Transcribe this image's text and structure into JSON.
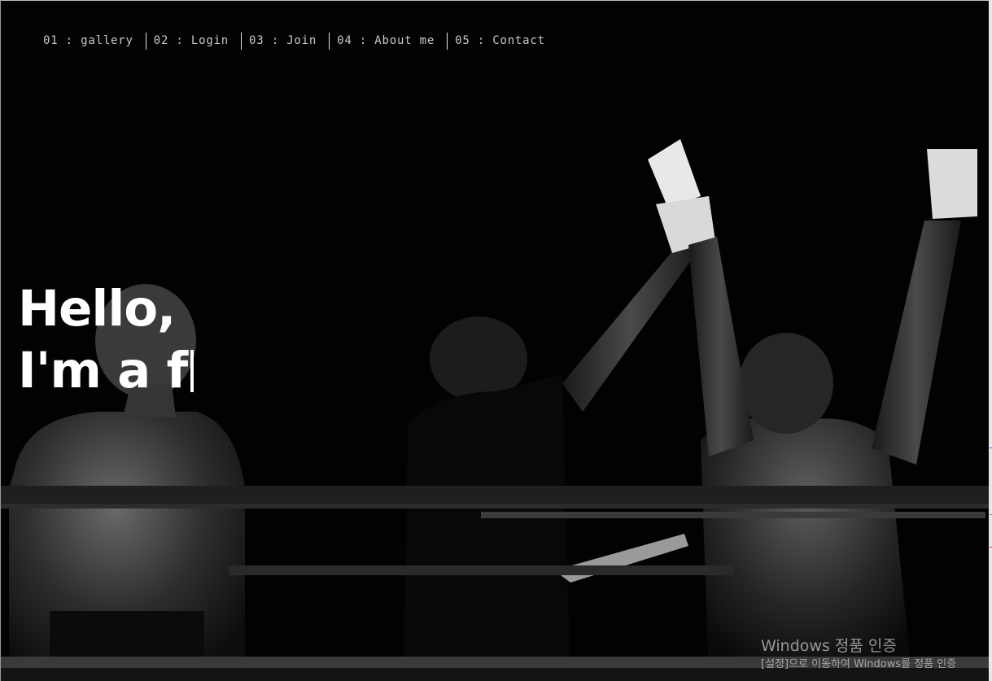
{
  "nav": {
    "items": [
      {
        "label": "01 : gallery"
      },
      {
        "label": "02 : Login"
      },
      {
        "label": "03 : Join"
      },
      {
        "label": "04 : About me"
      },
      {
        "label": "05 : Contact"
      }
    ]
  },
  "hero": {
    "line1": "Hello,",
    "line2": "I'm a f"
  },
  "watermark": {
    "title": "Windows 정품 인증",
    "subtitle": "[설정]으로 이동하여 Windows를 정품 인증"
  },
  "colors": {
    "background": "#000000",
    "nav_text": "#c9c9c9",
    "headline": "#ffffff"
  }
}
